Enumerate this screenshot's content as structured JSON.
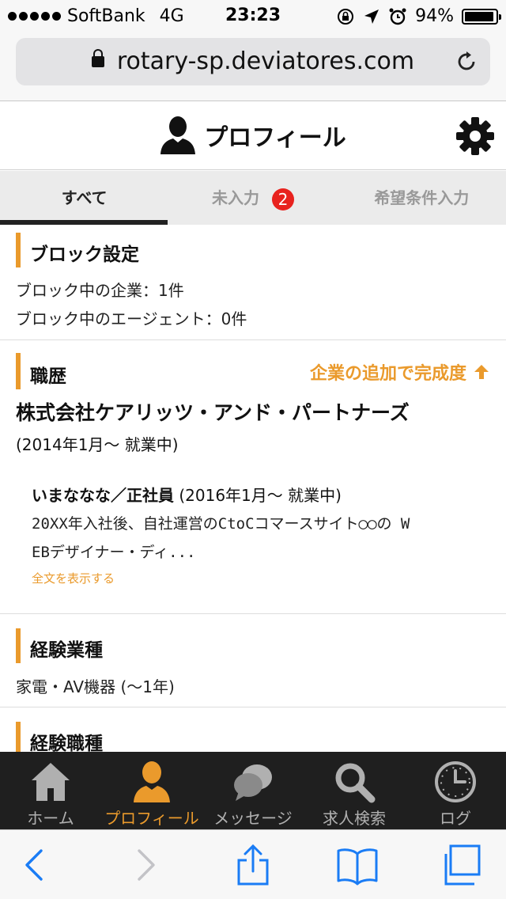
{
  "status_bar": {
    "carrier": "SoftBank",
    "network": "4G",
    "time": "23:23",
    "battery": "94%",
    "battery_level": 0.94
  },
  "browser": {
    "url": "rotary-sp.deviatores.com"
  },
  "header": {
    "title": "プロフィール"
  },
  "tabs": [
    {
      "label": "すべて",
      "active": true
    },
    {
      "label": "未入力",
      "badge": "2"
    },
    {
      "label": "希望条件入力"
    }
  ],
  "block": {
    "title": "ブロック設定",
    "companies": "ブロック中の企業：1件",
    "agents": "ブロック中のエージェント：0件"
  },
  "career": {
    "title": "職歴",
    "add_link": "企業の追加で完成度",
    "company": "株式会社ケアリッツ・アンド・パートナーズ",
    "company_period": "(2014年1月～ 就業中)",
    "job_name": "いまななな／正社員",
    "job_period": " (2016年1月～ 就業中)",
    "job_desc_1": "20XX年入社後、自社運営のCtoCコマースサイト◯◯の W",
    "job_desc_2": "EBデザイナー・ディ...",
    "more": "全文を表示する"
  },
  "industry": {
    "title": "経験業種",
    "value": "家電・AV機器 (～1年)"
  },
  "occupation": {
    "title": "経験職種"
  },
  "bottom_nav": [
    {
      "label": "ホーム",
      "icon": "home-icon"
    },
    {
      "label": "プロフィール",
      "icon": "person-icon",
      "active": true
    },
    {
      "label": "メッセージ",
      "icon": "chat-icon"
    },
    {
      "label": "求人検索",
      "icon": "search-icon"
    },
    {
      "label": "ログ",
      "icon": "clock-icon"
    }
  ],
  "colors": {
    "accent": "#ea9a2c",
    "badge": "#e8221e",
    "nav_bg": "#1f1f1f",
    "safari_blue": "#1a7cf5"
  }
}
